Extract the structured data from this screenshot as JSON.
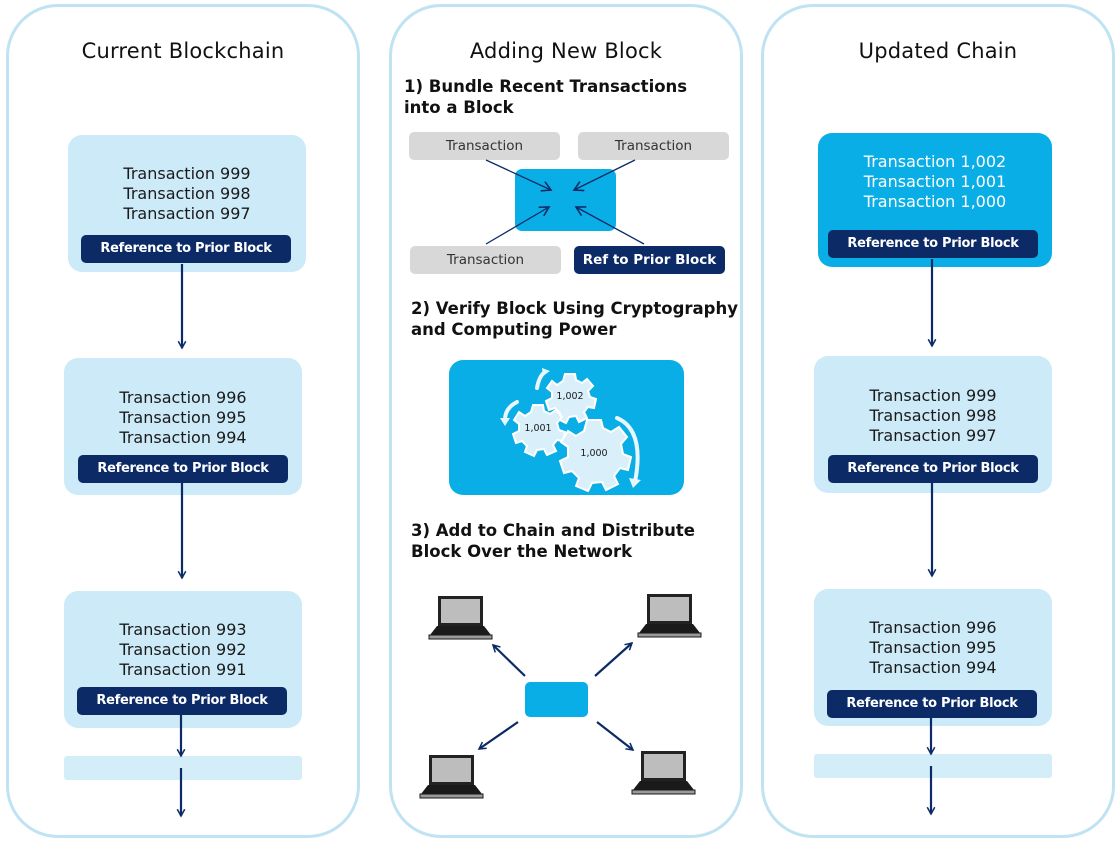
{
  "panels": {
    "current": {
      "title": "Current Blockchain",
      "blocks": [
        {
          "transactions": [
            "Transaction 999",
            "Transaction 998",
            "Transaction 997"
          ],
          "ref": "Reference to Prior Block"
        },
        {
          "transactions": [
            "Transaction 996",
            "Transaction 995",
            "Transaction 994"
          ],
          "ref": "Reference to Prior Block"
        },
        {
          "transactions": [
            "Transaction 993",
            "Transaction 992",
            "Transaction 991"
          ],
          "ref": "Reference to Prior Block"
        }
      ]
    },
    "adding": {
      "title": "Adding New Block",
      "step1": {
        "title_line1": "1) Bundle Recent Transactions",
        "title_line2": "into a Block",
        "chips": [
          "Transaction",
          "Transaction",
          "Transaction"
        ],
        "ref_chip": "Ref to Prior Block"
      },
      "step2": {
        "title_line1": "2) Verify Block Using Cryptography",
        "title_line2": "and Computing Power",
        "gears": [
          "1,002",
          "1,001",
          "1,000"
        ]
      },
      "step3": {
        "title_line1": "3) Add to Chain and Distribute",
        "title_line2": "Block Over the Network",
        "nodes": [
          "laptop",
          "laptop",
          "laptop",
          "laptop"
        ]
      }
    },
    "updated": {
      "title": "Updated Chain",
      "blocks": [
        {
          "transactions": [
            "Transaction 1,002",
            "Transaction 1,001",
            "Transaction 1,000"
          ],
          "ref": "Reference to Prior Block",
          "is_new": true
        },
        {
          "transactions": [
            "Transaction 999",
            "Transaction 998",
            "Transaction 997"
          ],
          "ref": "Reference to Prior Block"
        },
        {
          "transactions": [
            "Transaction 996",
            "Transaction 995",
            "Transaction 994"
          ],
          "ref": "Reference to Prior Block"
        }
      ]
    }
  },
  "colors": {
    "panel_border": "#bfe3f2",
    "old_block": "#cdeaf8",
    "new_block": "#0aaee6",
    "ref_bar": "#0b2a66",
    "arrow": "#0b2a66",
    "chip_gray": "#d8d8d8"
  }
}
